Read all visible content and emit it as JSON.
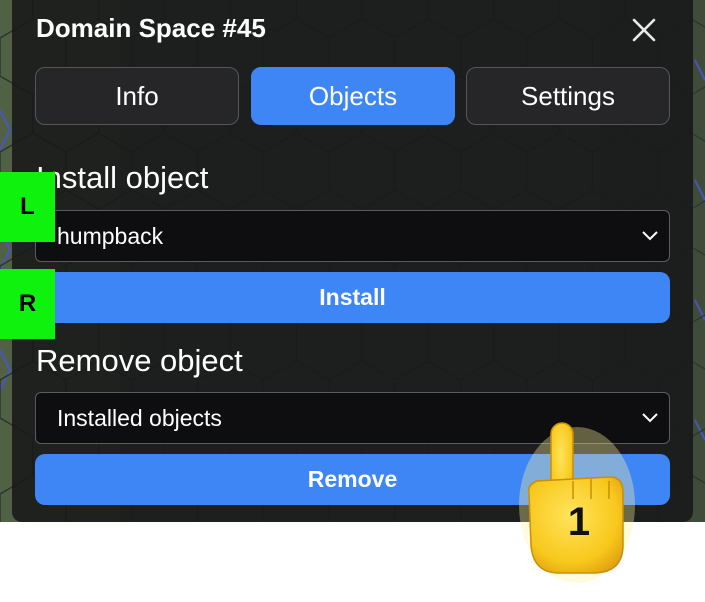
{
  "panel": {
    "title": "Domain Space #45",
    "close_icon": "close-icon"
  },
  "tabs": [
    {
      "label": "Info",
      "active": false
    },
    {
      "label": "Objects",
      "active": true
    },
    {
      "label": "Settings",
      "active": false
    }
  ],
  "install": {
    "section_label": "Install object",
    "select_value": "humpback",
    "button_label": "Install"
  },
  "remove": {
    "section_label": "Remove object",
    "select_value": "Installed objects",
    "button_label": "Remove"
  },
  "markers": {
    "left": "L",
    "right": "R"
  },
  "pointer": {
    "icon": "pointing-hand-icon",
    "step_number": "1"
  },
  "colors": {
    "accent": "#3e86f6",
    "panel_bg": "#18181a",
    "marker_green": "#0ef20e",
    "hand_yellow": "#f8c81c"
  }
}
